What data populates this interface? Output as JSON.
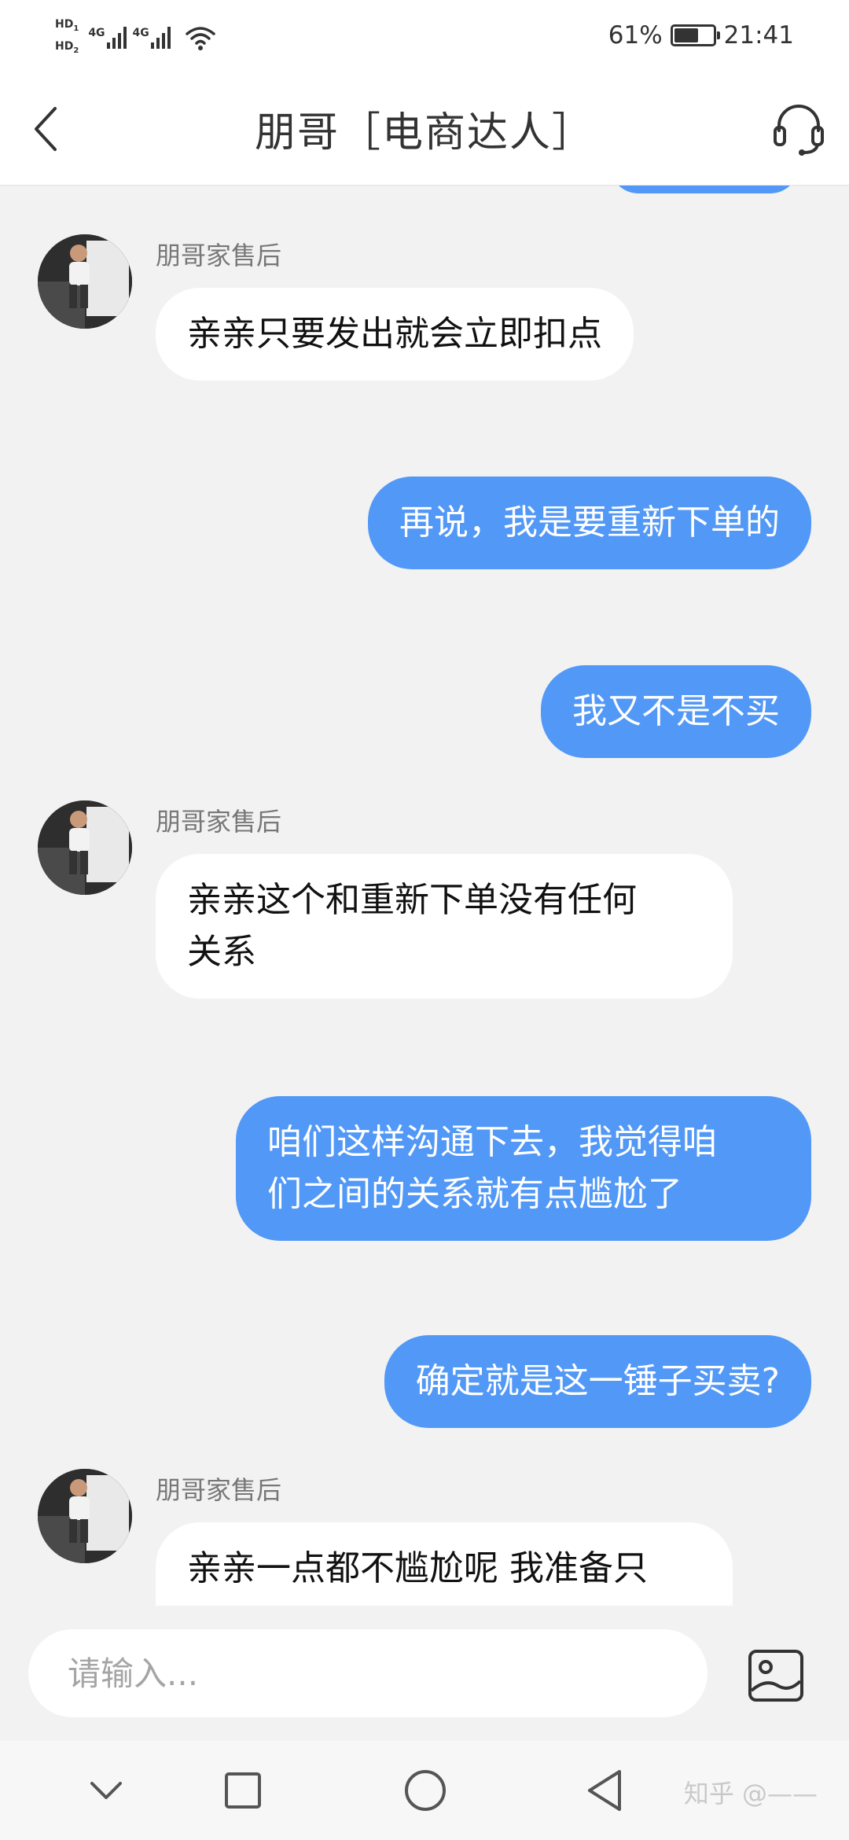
{
  "status_bar": {
    "hd1": "HD",
    "hd1_sub": "1",
    "hd2": "HD",
    "hd2_sub": "2",
    "net1": "4G",
    "net2": "4G",
    "battery_percent": "61%",
    "time": "21:41",
    "battery_level": 0.61
  },
  "header": {
    "title": "朋哥［电商达人］",
    "back_icon": "chevron-left-icon",
    "service_icon": "headset-icon"
  },
  "messages": [
    {
      "side": "in",
      "sender": "朋哥家售后",
      "lines": [
        "亲亲只要发出就会立即扣点"
      ]
    },
    {
      "side": "out",
      "lines": [
        "再说，我是要重新下单的"
      ]
    },
    {
      "side": "out",
      "lines": [
        "我又不是不买"
      ]
    },
    {
      "side": "in",
      "sender": "朋哥家售后",
      "lines": [
        "亲亲这个和重新下单没有任何",
        "关系"
      ]
    },
    {
      "side": "out",
      "lines": [
        "咱们这样沟通下去，我觉得咱",
        "们之间的关系就有点尴尬了"
      ]
    },
    {
      "side": "out",
      "lines": [
        "确定就是这一锤子买卖?"
      ]
    },
    {
      "side": "in",
      "sender": "朋哥家售后",
      "lines": [
        "亲亲一点都不尴尬呢 我准备只"
      ]
    }
  ],
  "input": {
    "placeholder": "请输入..."
  },
  "watermark": "知乎 @——",
  "colors": {
    "outgoing_bubble": "#5298f7",
    "incoming_bubble": "#ffffff",
    "chat_background": "#f2f2f2"
  }
}
